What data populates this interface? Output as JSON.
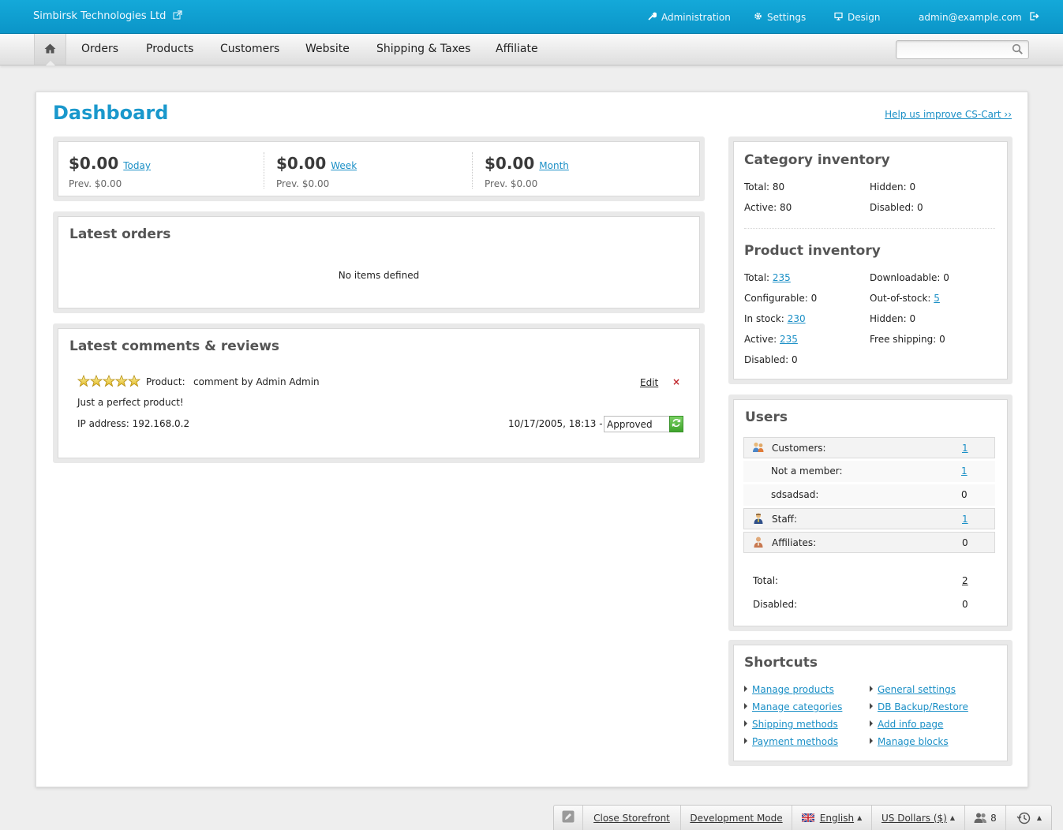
{
  "topbar": {
    "company": "Simbirsk Technologies Ltd",
    "administration": "Administration",
    "settings": "Settings",
    "design": "Design",
    "account": "admin@example.com"
  },
  "nav": {
    "items": [
      "Orders",
      "Products",
      "Customers",
      "Website",
      "Shipping & Taxes",
      "Affiliate"
    ],
    "search_placeholder": ""
  },
  "page": {
    "title": "Dashboard",
    "help_link": "Help us improve CS-Cart ››"
  },
  "stats": [
    {
      "amount": "$0.00",
      "period": "Today",
      "prev": "Prev. $0.00"
    },
    {
      "amount": "$0.00",
      "period": "Week",
      "prev": "Prev. $0.00"
    },
    {
      "amount": "$0.00",
      "period": "Month",
      "prev": "Prev. $0.00"
    }
  ],
  "latest_orders": {
    "title": "Latest orders",
    "empty": "No items defined"
  },
  "reviews": {
    "title": "Latest comments & reviews",
    "rating": 5,
    "product_label": "Product:",
    "author": "comment by Admin Admin",
    "edit": "Edit",
    "text": "Just a perfect product!",
    "ip": "IP address: 192.168.0.2",
    "date": "10/17/2005, 18:13 -",
    "status": "Approved"
  },
  "category_inventory": {
    "title": "Category inventory",
    "total": "Total: 80",
    "hidden": "Hidden: 0",
    "active": "Active: 80",
    "disabled": "Disabled: 0"
  },
  "product_inventory": {
    "title": "Product inventory",
    "total_label": "Total:",
    "total_value": "235",
    "configurable": "Configurable: 0",
    "in_stock_label": "In stock:",
    "in_stock_value": "230",
    "active_label": "Active:",
    "active_value": "235",
    "disabled": "Disabled: 0",
    "downloadable": "Downloadable: 0",
    "out_of_stock_label": "Out-of-stock:",
    "out_of_stock_value": "5",
    "hidden": "Hidden: 0",
    "free_shipping": "Free shipping: 0"
  },
  "users": {
    "title": "Users",
    "rows": [
      {
        "label": "Customers:",
        "value": "1"
      },
      {
        "label": "Not a member:",
        "value": "1"
      },
      {
        "label": "sdsadsad:",
        "value": "0"
      },
      {
        "label": "Staff:",
        "value": "1"
      },
      {
        "label": "Affiliates:",
        "value": "0"
      }
    ],
    "total_label": "Total:",
    "total_value": "2",
    "disabled_label": "Disabled:",
    "disabled_value": "0"
  },
  "shortcuts": {
    "title": "Shortcuts",
    "left": [
      "Manage products",
      "Manage categories",
      "Shipping methods",
      "Payment methods"
    ],
    "right": [
      "General settings",
      "DB Backup/Restore",
      "Add info page",
      "Manage blocks"
    ]
  },
  "bottombar": {
    "close_storefront": "Close Storefront",
    "dev_mode": "Development Mode",
    "language": "English",
    "currency": "US Dollars ($)",
    "users_online": "8"
  },
  "colors": {
    "accent": "#1a98cc",
    "topbar": "#0b95c8",
    "link": "#1a8fc6"
  }
}
